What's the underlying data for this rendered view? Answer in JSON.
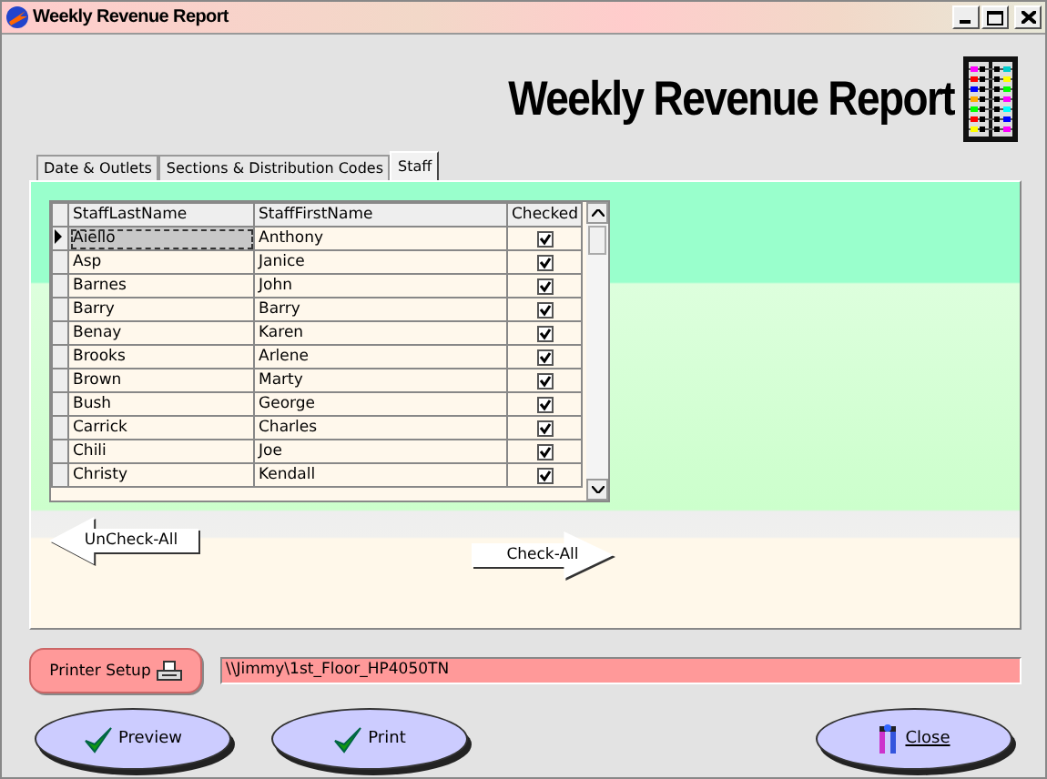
{
  "window": {
    "title": "Weekly Revenue Report"
  },
  "header": {
    "title": "Weekly Revenue Report"
  },
  "tabs": [
    {
      "label": "Date & Outlets",
      "selected": false
    },
    {
      "label": "Sections & Distribution Codes",
      "selected": false
    },
    {
      "label": "Staff",
      "selected": true
    }
  ],
  "table": {
    "columns": [
      "StaffLastName",
      "StaffFirstName",
      "Checked"
    ],
    "rows": [
      {
        "last": "Aiello",
        "first": "Anthony",
        "checked": true,
        "selected": true
      },
      {
        "last": "Asp",
        "first": "Janice",
        "checked": true,
        "selected": false
      },
      {
        "last": "Barnes",
        "first": "John",
        "checked": true,
        "selected": false
      },
      {
        "last": "Barry",
        "first": "Barry",
        "checked": true,
        "selected": false
      },
      {
        "last": "Benay",
        "first": "Karen",
        "checked": true,
        "selected": false
      },
      {
        "last": "Brooks",
        "first": "Arlene",
        "checked": true,
        "selected": false
      },
      {
        "last": "Brown",
        "first": "Marty",
        "checked": true,
        "selected": false
      },
      {
        "last": "Bush",
        "first": "George",
        "checked": true,
        "selected": false
      },
      {
        "last": "Carrick",
        "first": "Charles",
        "checked": true,
        "selected": false
      },
      {
        "last": "Chili",
        "first": "Joe",
        "checked": true,
        "selected": false
      },
      {
        "last": "Christy",
        "first": "Kendall",
        "checked": true,
        "selected": false
      }
    ]
  },
  "uncheck_all": "UnCheck-All",
  "check_all": "Check-All",
  "printer_setup": "Printer Setup",
  "printer_path": "\\\\Jimmy\\1st_Floor_HP4050TN",
  "buttons": {
    "preview": "Preview",
    "print": "Print",
    "close": "Close"
  }
}
